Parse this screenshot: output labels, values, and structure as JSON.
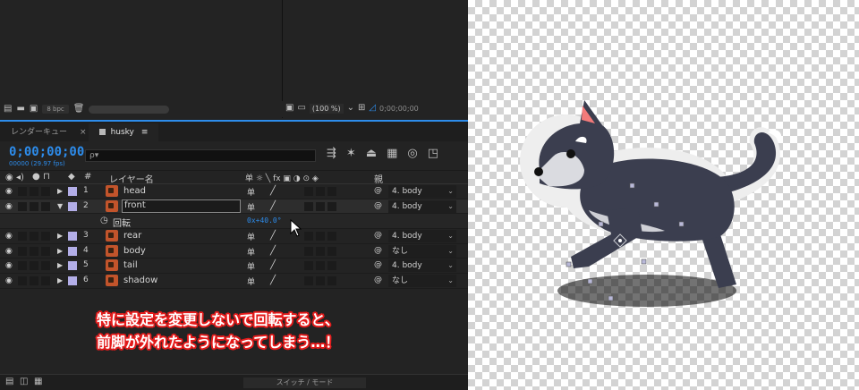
{
  "project": {
    "bpc": "8 bpc"
  },
  "viewer": {
    "zoom": "(100 %)",
    "timecode": "0;00;00;00"
  },
  "timeline": {
    "tabs": [
      {
        "label": "レンダーキュー"
      },
      {
        "label": "husky"
      }
    ],
    "timecode": "0;00;00;00",
    "fps": "00000 (29.97 fps)",
    "search_placeholder": "ρ▾",
    "columns": {
      "layer_name": "レイヤー名",
      "parent": "親"
    },
    "layers": [
      {
        "num": "1",
        "name": "head",
        "parent": "4. body"
      },
      {
        "num": "2",
        "name": "front",
        "parent": "4. body"
      },
      {
        "num": "3",
        "name": "rear",
        "parent": "4. body"
      },
      {
        "num": "4",
        "name": "body",
        "parent": "なし"
      },
      {
        "num": "5",
        "name": "tail",
        "parent": "4. body"
      },
      {
        "num": "6",
        "name": "shadow",
        "parent": "なし"
      }
    ],
    "property": {
      "name": "回転",
      "value": "0x+40.0°"
    },
    "switch_mode": "スイッチ / モード"
  },
  "caption": {
    "line1": "特に設定を変更しないで回転すると、",
    "line2": "前脚が外れたようになってしまう…！"
  },
  "colors": {
    "accent": "#2d8ceb",
    "label": "#b3aee8",
    "layer_icon": "#c2542b",
    "caption_outline": "#e41b1b"
  }
}
